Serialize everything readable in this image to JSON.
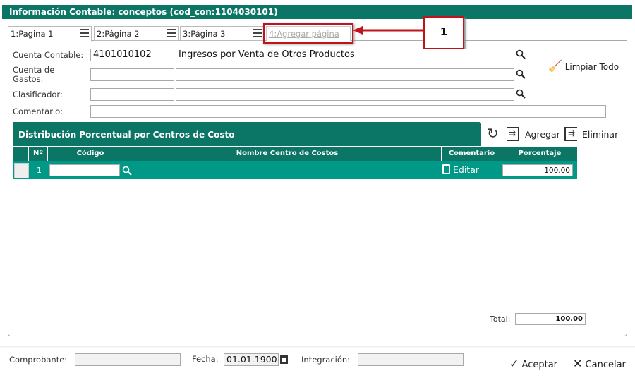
{
  "title": "Información Contable: conceptos (cod_con:1104030101)",
  "tabs": [
    {
      "label": "1:Pagina 1"
    },
    {
      "label": "2:Página 2"
    },
    {
      "label": "3:Página 3"
    },
    {
      "label": "4:Agregar página"
    }
  ],
  "callout": {
    "label": "1",
    "color": "#c0141c"
  },
  "form": {
    "cuenta_contable": {
      "label": "Cuenta Contable:",
      "code": "4101010102",
      "desc": "Ingresos por Venta de Otros Productos"
    },
    "cuenta_gastos": {
      "label": "Cuenta de Gastos:",
      "code": "",
      "desc": ""
    },
    "clasificador": {
      "label": "Clasificador:",
      "code": "",
      "desc": ""
    },
    "comentario": {
      "label": "Comentario:",
      "value": ""
    },
    "limpiar": "Limpiar Todo"
  },
  "section": {
    "title": "Distribución Porcentual por Centros de Costo",
    "agregar": "Agregar",
    "eliminar": "Eliminar"
  },
  "table": {
    "headers": [
      "Nº",
      "Código",
      "Nombre Centro de Costos",
      "Comentario",
      "Porcentaje"
    ],
    "rows": [
      {
        "n": "1",
        "codigo": "",
        "nombre": "",
        "comentario": "Editar",
        "porcentaje": "100.00"
      }
    ]
  },
  "total": {
    "label": "Total:",
    "value": "100.00"
  },
  "footer": {
    "comprobante_label": "Comprobante:",
    "comprobante": "",
    "fecha_label": "Fecha:",
    "fecha": "01.01.1900",
    "integracion_label": "Integración:",
    "integracion": "",
    "aceptar": "Aceptar",
    "cancelar": "Cancelar"
  },
  "colors": {
    "header": "#0b7566",
    "row": "#009886"
  }
}
